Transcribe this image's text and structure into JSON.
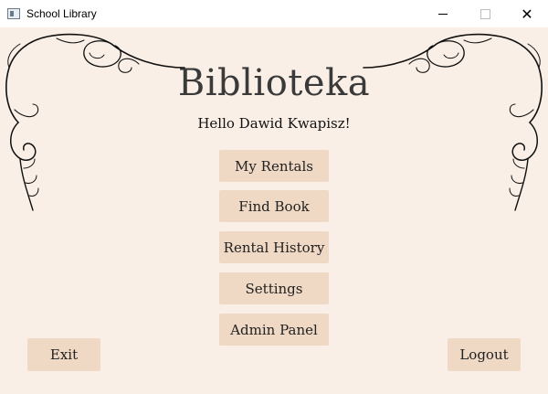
{
  "window": {
    "title": "School Library",
    "controls": {
      "minimize": "minimize",
      "maximize": "maximize",
      "close": "✕"
    }
  },
  "header": {
    "title": "Biblioteka",
    "greeting": "Hello Dawid Kwapisz!"
  },
  "menu": {
    "my_rentals": "My Rentals",
    "find_book": "Find Book",
    "rental_history": "Rental History",
    "settings": "Settings",
    "admin_panel": "Admin Panel"
  },
  "footer": {
    "exit": "Exit",
    "logout": "Logout"
  },
  "colors": {
    "background": "#faefe6",
    "button": "#efd8c4",
    "titlebar": "#ffffff"
  }
}
